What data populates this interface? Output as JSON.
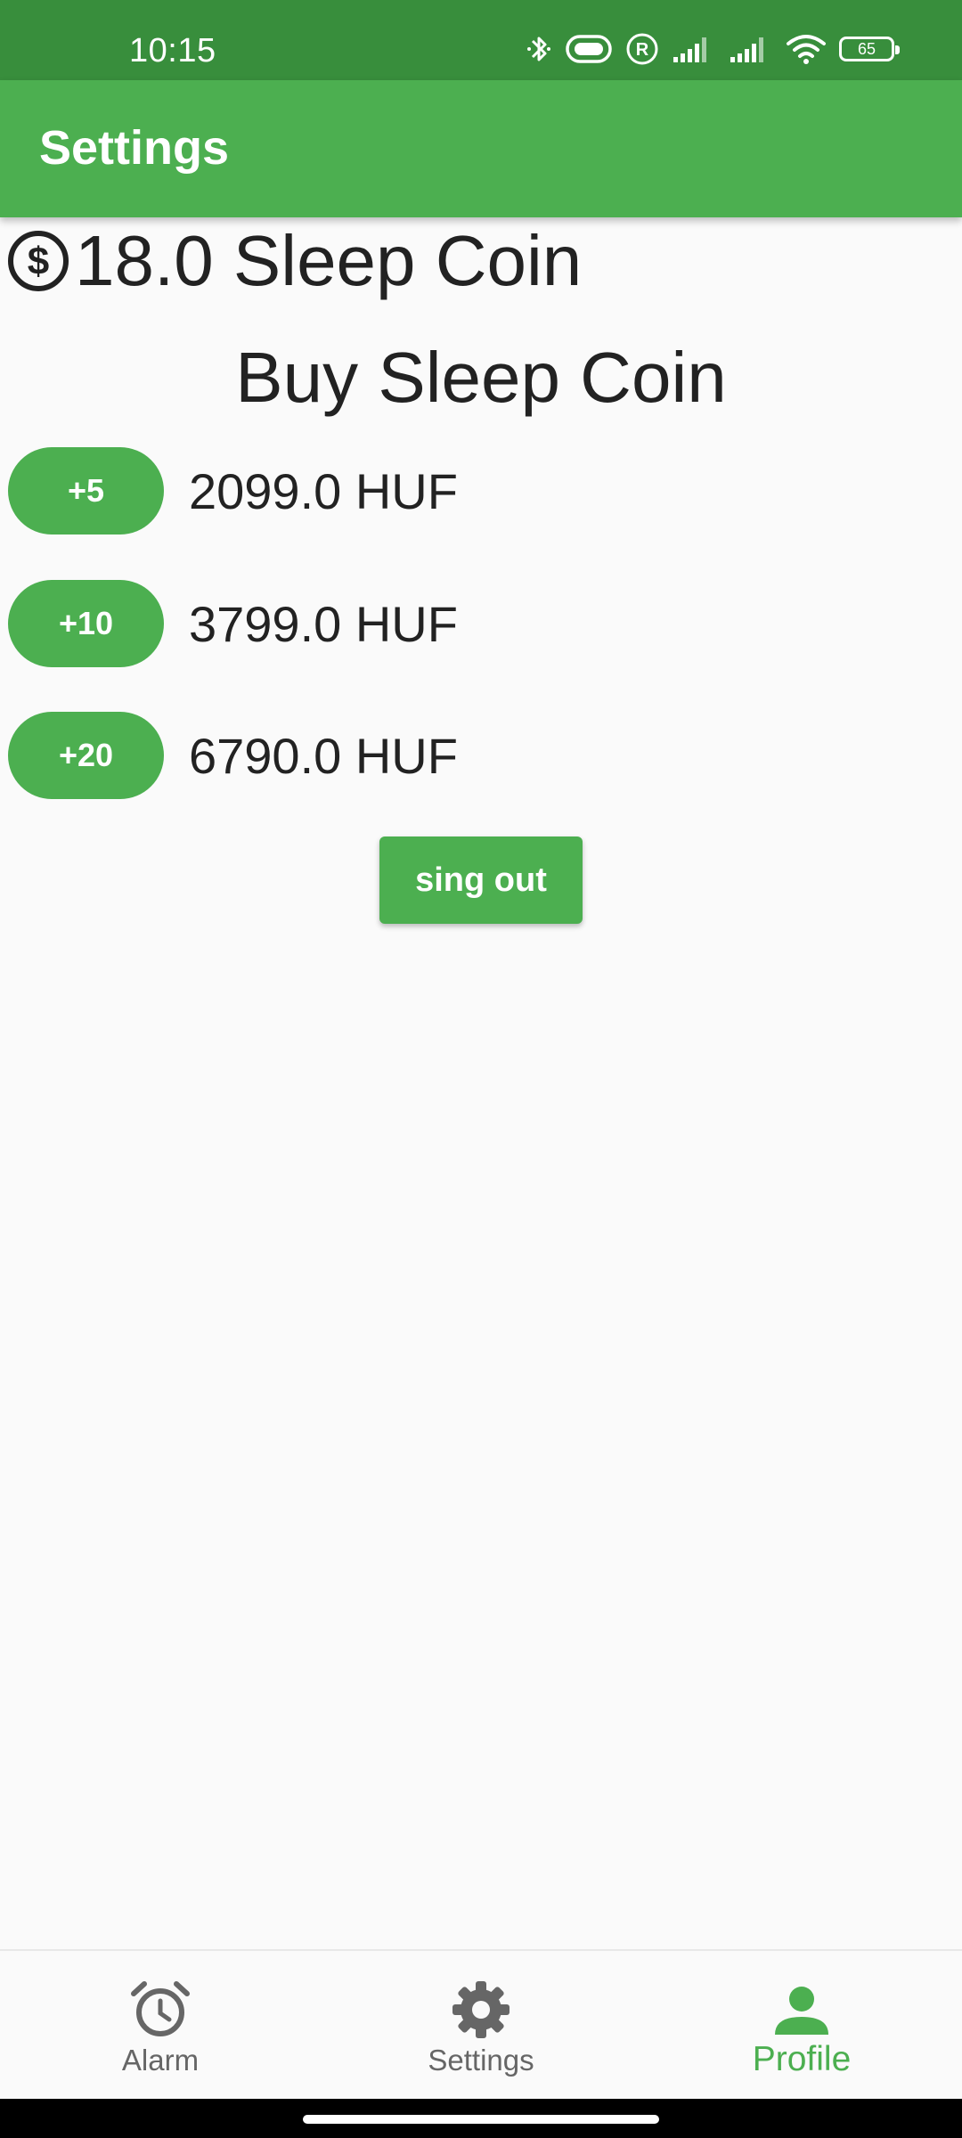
{
  "status_bar": {
    "time": "10:15",
    "battery": "65",
    "icons": [
      "bluetooth-icon",
      "vibrate-icon",
      "roaming-icon",
      "signal-icon",
      "signal-icon",
      "wifi-icon",
      "battery-icon"
    ]
  },
  "app_bar": {
    "title": "Settings"
  },
  "balance": {
    "icon": "dollar-circle-icon",
    "text": "18.0 Sleep Coin"
  },
  "buy": {
    "title": "Buy Sleep Coin",
    "packs": [
      {
        "label": "+5",
        "price": "2099.0 HUF"
      },
      {
        "label": "+10",
        "price": "3799.0 HUF"
      },
      {
        "label": "+20",
        "price": "6790.0 HUF"
      }
    ]
  },
  "signout_label": "sing out",
  "bottom_nav": {
    "items": [
      {
        "label": "Alarm",
        "icon": "alarm-clock-icon"
      },
      {
        "label": "Settings",
        "icon": "gear-icon"
      },
      {
        "label": "Profile",
        "icon": "person-icon"
      }
    ],
    "active": "Profile"
  },
  "colors": {
    "primary": "#4caf50",
    "status_bar": "#388e3c",
    "background": "#fafafa",
    "inactive_nav": "#666666"
  }
}
